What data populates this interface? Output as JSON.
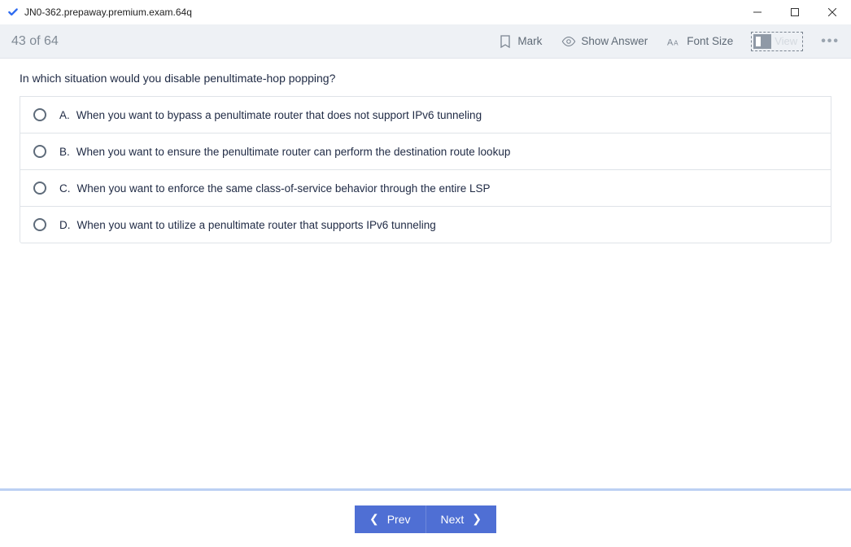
{
  "window": {
    "title": "JN0-362.prepaway.premium.exam.64q"
  },
  "toolbar": {
    "counter": "43 of 64",
    "mark": "Mark",
    "show_answer": "Show Answer",
    "font_size": "Font Size",
    "view": "View"
  },
  "question": {
    "text": "In which situation would you disable penultimate-hop popping?",
    "options": [
      {
        "letter": "A.",
        "text": "When you want to bypass a penultimate router that does not support IPv6 tunneling"
      },
      {
        "letter": "B.",
        "text": "When you want to ensure the penultimate router can perform the destination route lookup"
      },
      {
        "letter": "C.",
        "text": "When you want to enforce the same class-of-service behavior through the entire LSP"
      },
      {
        "letter": "D.",
        "text": "When you want to utilize a penultimate router that supports IPv6 tunneling"
      }
    ]
  },
  "footer": {
    "prev": "Prev",
    "next": "Next"
  }
}
